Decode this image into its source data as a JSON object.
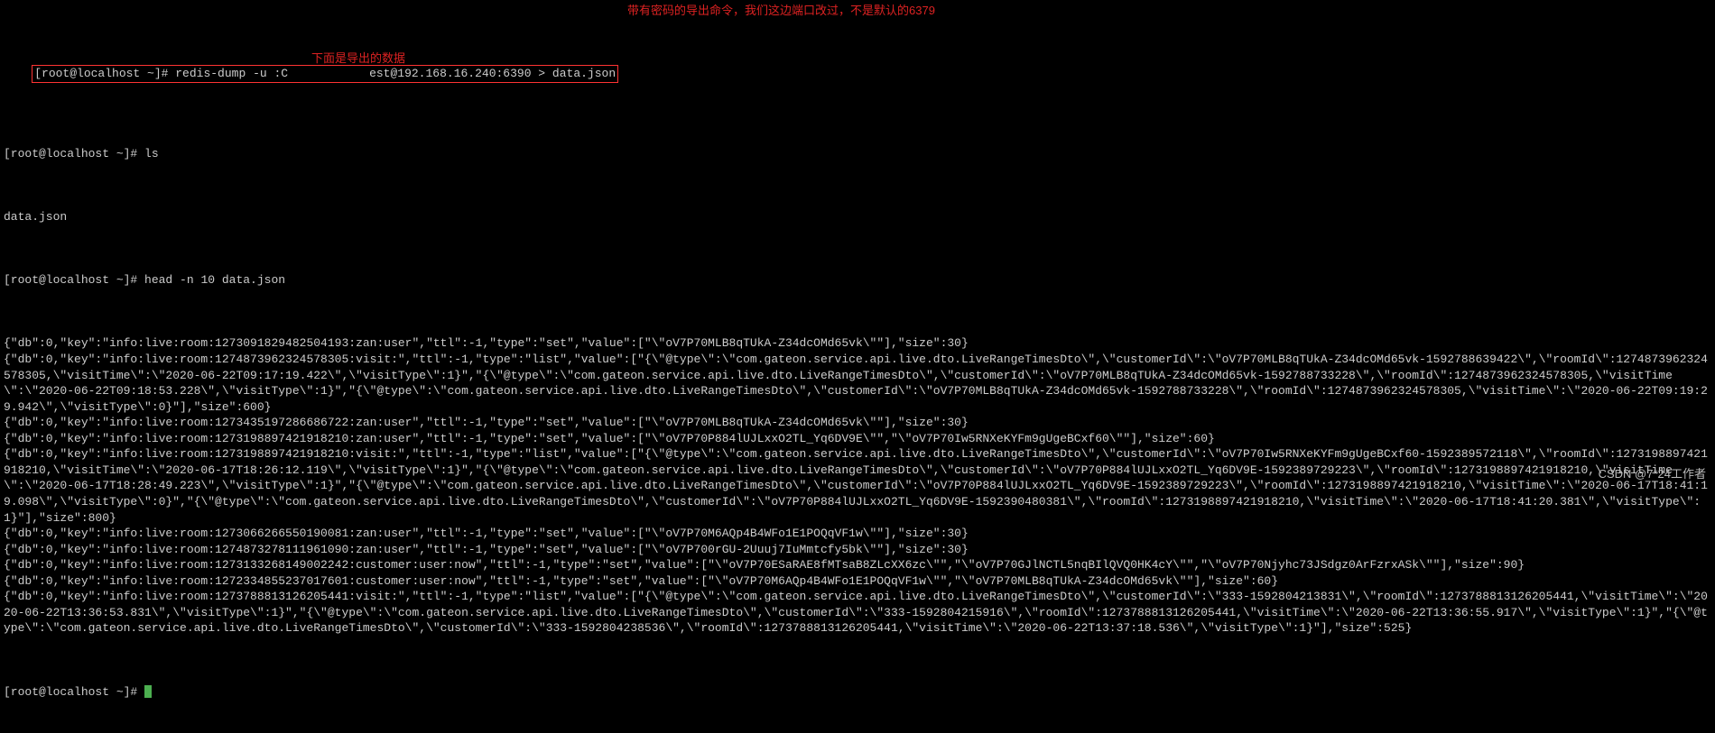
{
  "prompt": "[root@localhost ~]# ",
  "cmd1_pre": "redis-dump -u :C",
  "cmd1_post": "est@192.168.16.240:6390 > data.json",
  "cmd2": "ls",
  "ls_out": "data.json",
  "cmd3": "head -n 10 data.json",
  "annot1": "带有密码的导出命令，我们这边端口改过，不是默认的6379",
  "annot2": "下面是导出的数据",
  "footer": "CSDN @7*24工作者",
  "lines": [
    "{\"db\":0,\"key\":\"info:live:room:1273091829482504193:zan:user\",\"ttl\":-1,\"type\":\"set\",\"value\":[\"\\\"oV7P70MLB8qTUkA-Z34dcOMd65vk\\\"\"],\"size\":30}",
    "{\"db\":0,\"key\":\"info:live:room:1274873962324578305:visit:\",\"ttl\":-1,\"type\":\"list\",\"value\":[\"{\\\"@type\\\":\\\"com.gateon.service.api.live.dto.LiveRangeTimesDto\\\",\\\"customerId\\\":\\\"oV7P70MLB8qTUkA-Z34dcOMd65vk-1592788639422\\\",\\\"roomId\\\":1274873962324578305,\\\"visitTime\\\":\\\"2020-06-22T09:17:19.422\\\",\\\"visitType\\\":1}\",\"{\\\"@type\\\":\\\"com.gateon.service.api.live.dto.LiveRangeTimesDto\\\",\\\"customerId\\\":\\\"oV7P70MLB8qTUkA-Z34dcOMd65vk-1592788733228\\\",\\\"roomId\\\":1274873962324578305,\\\"visitTime\\\":\\\"2020-06-22T09:18:53.228\\\",\\\"visitType\\\":1}\",\"{\\\"@type\\\":\\\"com.gateon.service.api.live.dto.LiveRangeTimesDto\\\",\\\"customerId\\\":\\\"oV7P70MLB8qTUkA-Z34dcOMd65vk-1592788733228\\\",\\\"roomId\\\":1274873962324578305,\\\"visitTime\\\":\\\"2020-06-22T09:19:29.942\\\",\\\"visitType\\\":0}\"],\"size\":600}",
    "{\"db\":0,\"key\":\"info:live:room:1273435197286686722:zan:user\",\"ttl\":-1,\"type\":\"set\",\"value\":[\"\\\"oV7P70MLB8qTUkA-Z34dcOMd65vk\\\"\"],\"size\":30}",
    "{\"db\":0,\"key\":\"info:live:room:1273198897421918210:zan:user\",\"ttl\":-1,\"type\":\"set\",\"value\":[\"\\\"oV7P70P884lUJLxxO2TL_Yq6DV9E\\\"\",\"\\\"oV7P70Iw5RNXeKYFm9gUgeBCxf60\\\"\"],\"size\":60}",
    "{\"db\":0,\"key\":\"info:live:room:1273198897421918210:visit:\",\"ttl\":-1,\"type\":\"list\",\"value\":[\"{\\\"@type\\\":\\\"com.gateon.service.api.live.dto.LiveRangeTimesDto\\\",\\\"customerId\\\":\\\"oV7P70Iw5RNXeKYFm9gUgeBCxf60-1592389572118\\\",\\\"roomId\\\":1273198897421918210,\\\"visitTime\\\":\\\"2020-06-17T18:26:12.119\\\",\\\"visitType\\\":1}\",\"{\\\"@type\\\":\\\"com.gateon.service.api.live.dto.LiveRangeTimesDto\\\",\\\"customerId\\\":\\\"oV7P70P884lUJLxxO2TL_Yq6DV9E-1592389729223\\\",\\\"roomId\\\":1273198897421918210,\\\"visitTime\\\":\\\"2020-06-17T18:28:49.223\\\",\\\"visitType\\\":1}\",\"{\\\"@type\\\":\\\"com.gateon.service.api.live.dto.LiveRangeTimesDto\\\",\\\"customerId\\\":\\\"oV7P70P884lUJLxxO2TL_Yq6DV9E-1592389729223\\\",\\\"roomId\\\":1273198897421918210,\\\"visitTime\\\":\\\"2020-06-17T18:41:19.098\\\",\\\"visitType\\\":0}\",\"{\\\"@type\\\":\\\"com.gateon.service.api.live.dto.LiveRangeTimesDto\\\",\\\"customerId\\\":\\\"oV7P70P884lUJLxxO2TL_Yq6DV9E-1592390480381\\\",\\\"roomId\\\":1273198897421918210,\\\"visitTime\\\":\\\"2020-06-17T18:41:20.381\\\",\\\"visitType\\\":1}\"],\"size\":800}",
    "{\"db\":0,\"key\":\"info:live:room:1273066266550190081:zan:user\",\"ttl\":-1,\"type\":\"set\",\"value\":[\"\\\"oV7P70M6AQp4B4WFo1E1POQqVF1w\\\"\"],\"size\":30}",
    "{\"db\":0,\"key\":\"info:live:room:1274873278111961090:zan:user\",\"ttl\":-1,\"type\":\"set\",\"value\":[\"\\\"oV7P700rGU-2Uuuj7IuMmtcfy5bk\\\"\"],\"size\":30}",
    "{\"db\":0,\"key\":\"info:live:room:1273133268149002242:customer:user:now\",\"ttl\":-1,\"type\":\"set\",\"value\":[\"\\\"oV7P70ESaRAE8fMTsaB8ZLcXX6zc\\\"\",\"\\\"oV7P70GJlNCTL5nqBIlQVQ0HK4cY\\\"\",\"\\\"oV7P70Njyhc73JSdgz0ArFzrxASk\\\"\"],\"size\":90}",
    "{\"db\":0,\"key\":\"info:live:room:1272334855237017601:customer:user:now\",\"ttl\":-1,\"type\":\"set\",\"value\":[\"\\\"oV7P70M6AQp4B4WFo1E1POQqVF1w\\\"\",\"\\\"oV7P70MLB8qTUkA-Z34dcOMd65vk\\\"\"],\"size\":60}",
    "{\"db\":0,\"key\":\"info:live:room:1273788813126205441:visit:\",\"ttl\":-1,\"type\":\"list\",\"value\":[\"{\\\"@type\\\":\\\"com.gateon.service.api.live.dto.LiveRangeTimesDto\\\",\\\"customerId\\\":\\\"333-1592804213831\\\",\\\"roomId\\\":1273788813126205441,\\\"visitTime\\\":\\\"2020-06-22T13:36:53.831\\\",\\\"visitType\\\":1}\",\"{\\\"@type\\\":\\\"com.gateon.service.api.live.dto.LiveRangeTimesDto\\\",\\\"customerId\\\":\\\"333-1592804215916\\\",\\\"roomId\\\":1273788813126205441,\\\"visitTime\\\":\\\"2020-06-22T13:36:55.917\\\",\\\"visitType\\\":1}\",\"{\\\"@type\\\":\\\"com.gateon.service.api.live.dto.LiveRangeTimesDto\\\",\\\"customerId\\\":\\\"333-1592804238536\\\",\\\"roomId\\\":1273788813126205441,\\\"visitTime\\\":\\\"2020-06-22T13:37:18.536\\\",\\\"visitType\\\":1}\"],\"size\":525}"
  ]
}
